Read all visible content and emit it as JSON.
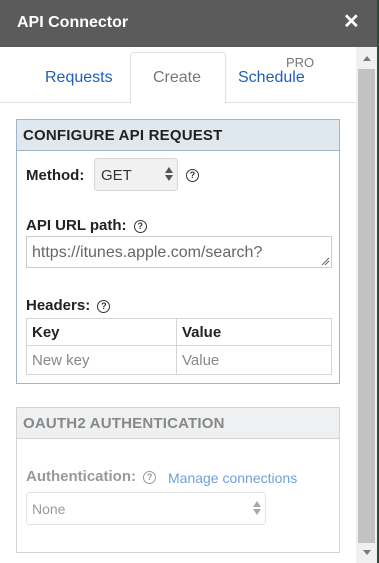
{
  "window": {
    "title": "API Connector",
    "close_glyph": "✕"
  },
  "tabs": [
    {
      "label": "Requests",
      "active": false
    },
    {
      "label": "Create",
      "active": true
    },
    {
      "label": "Schedule",
      "active": false,
      "badge": "PRO"
    }
  ],
  "configure": {
    "header": "CONFIGURE API REQUEST",
    "method_label": "Method:",
    "method_value": "GET",
    "url_label": "API URL path:",
    "url_value": "https://itunes.apple.com/search?",
    "headers_label": "Headers:",
    "headers_table": {
      "columns": [
        "Key",
        "Value"
      ],
      "new_row": {
        "key_placeholder": "New key",
        "value_placeholder": "Value"
      }
    }
  },
  "oauth": {
    "header": "OAUTH2 AUTHENTICATION",
    "auth_label": "Authentication:",
    "manage_link": "Manage connections",
    "auth_value": "None"
  },
  "icons": {
    "help": "help-circle-icon",
    "close": "close-icon",
    "select_arrows": "select-arrows-icon",
    "resize": "resize-grip-icon"
  },
  "colors": {
    "titlebar": "#5b5b5b",
    "link": "#1f5fb8",
    "section_header": "#dfe7ef",
    "section_border": "#9fb6c9"
  }
}
